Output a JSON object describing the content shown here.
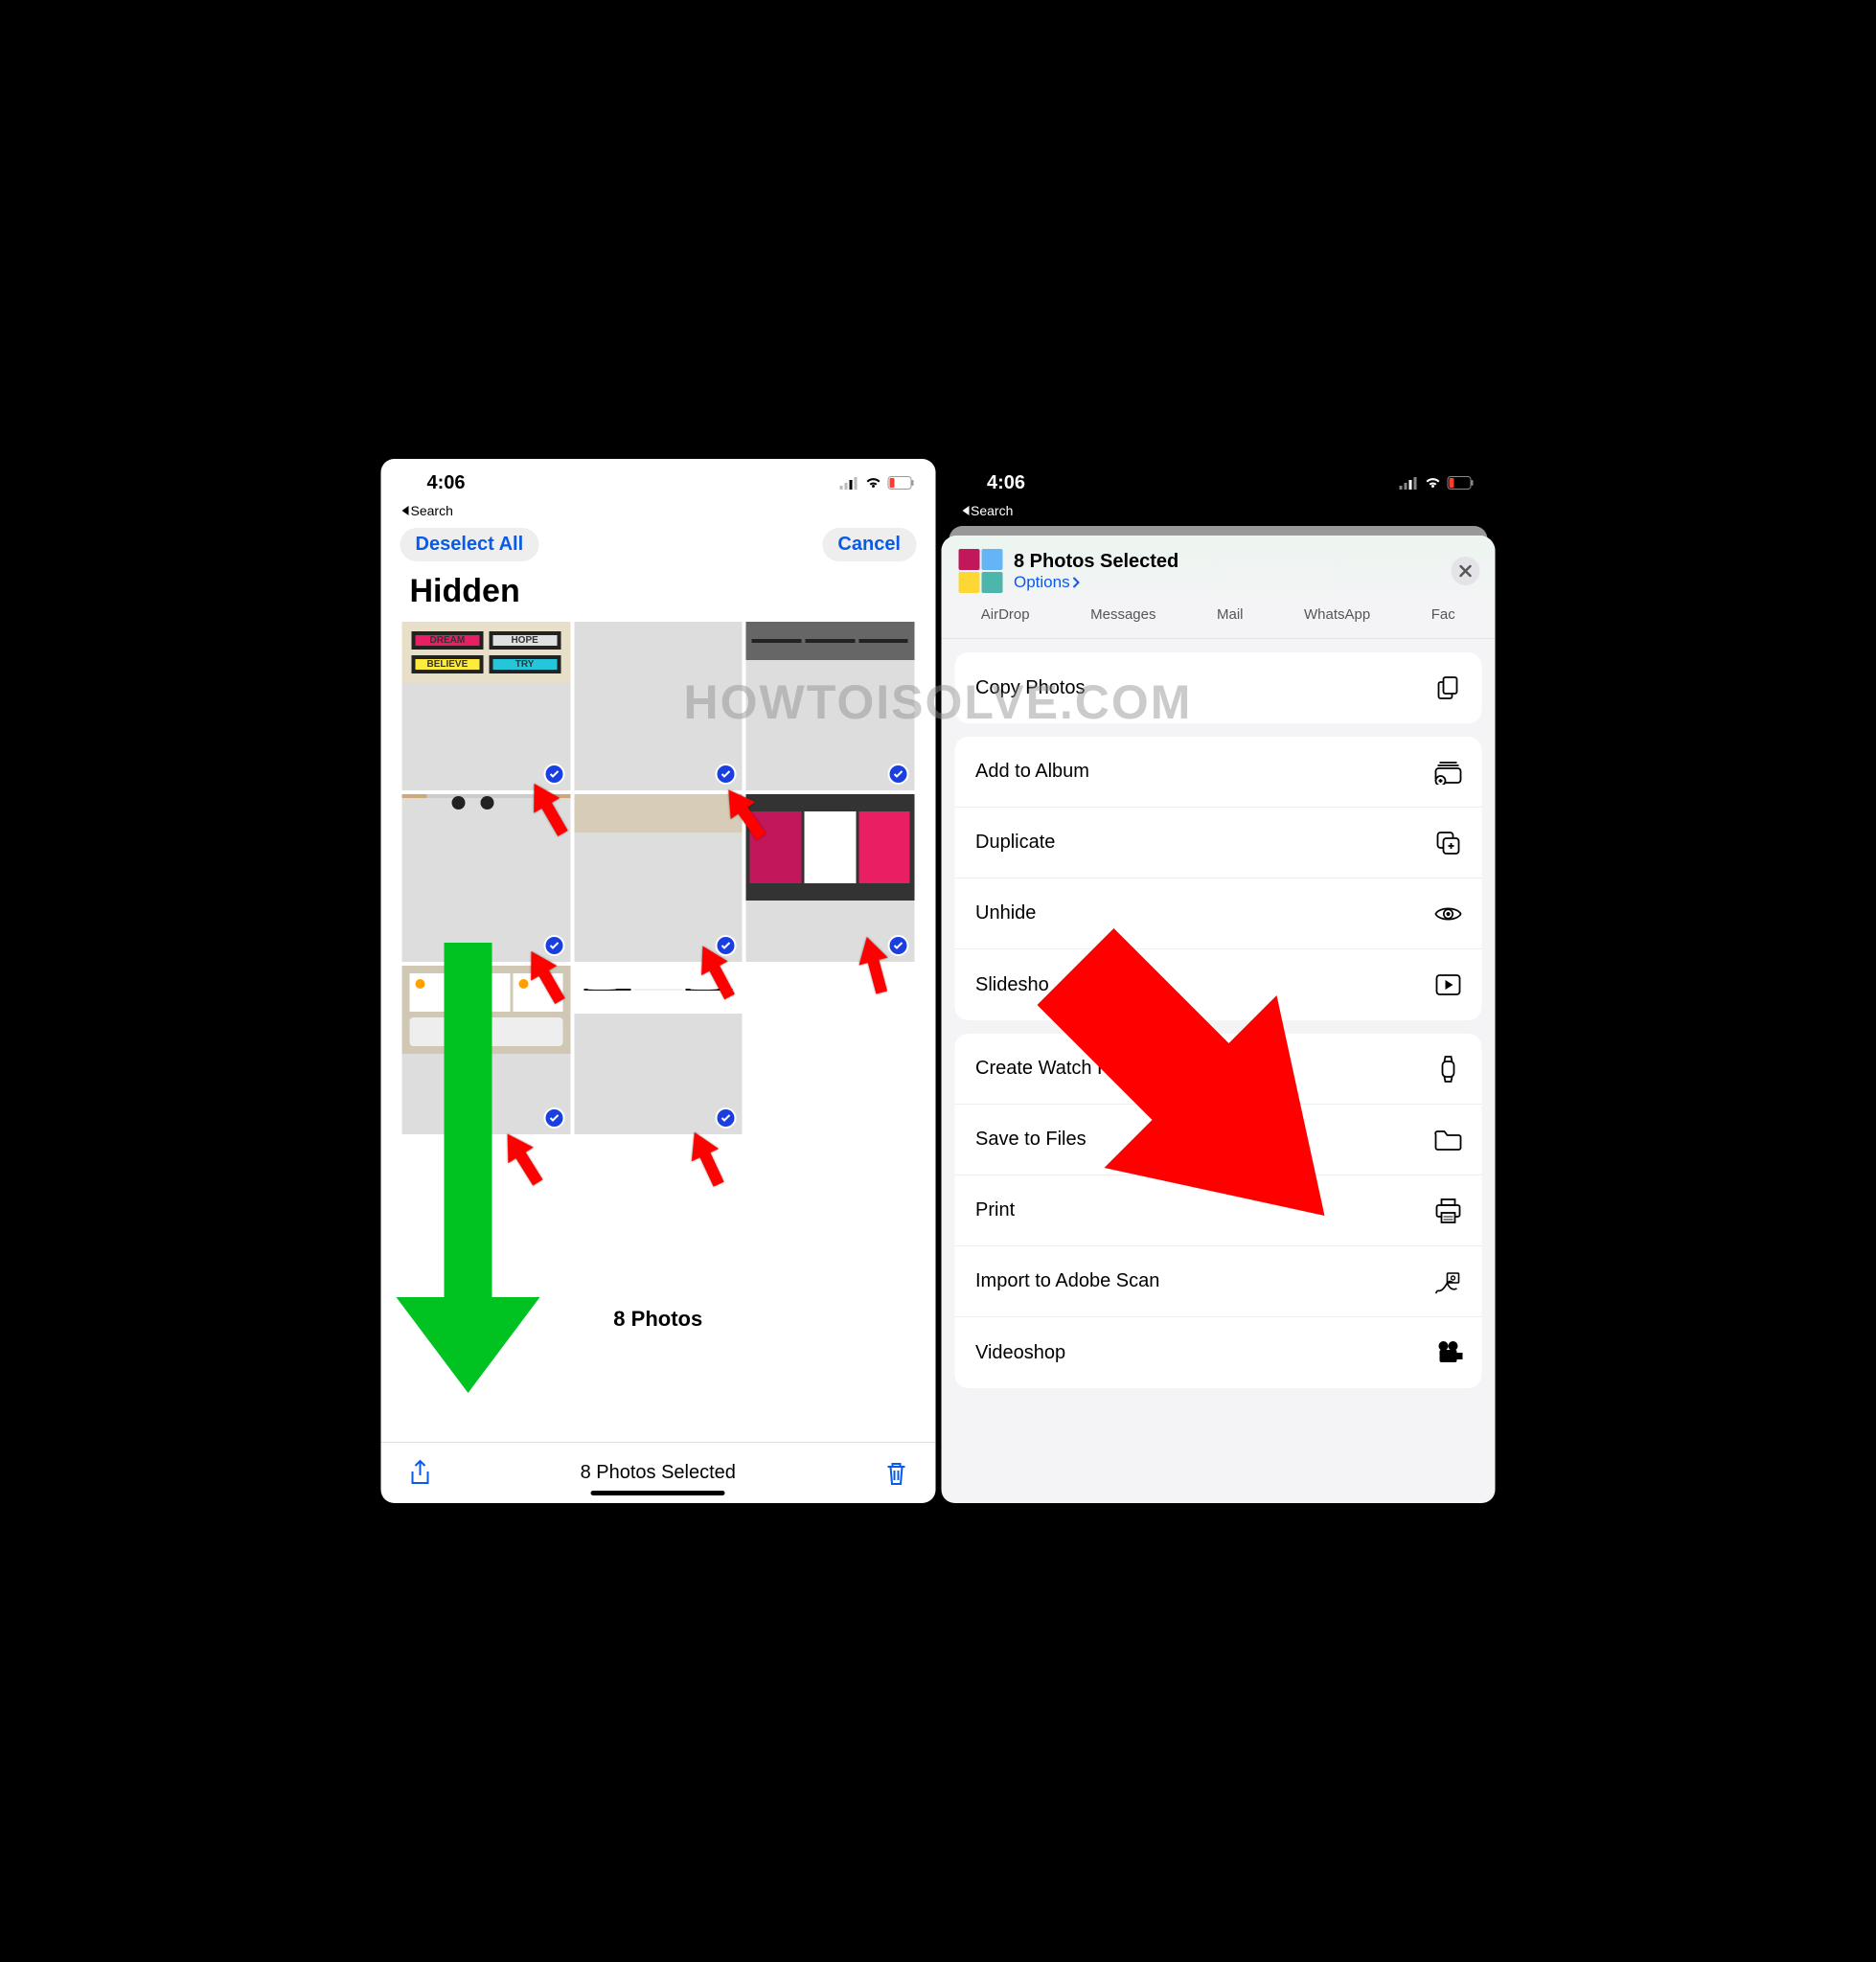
{
  "status": {
    "time": "4:06",
    "back_label": "Search"
  },
  "left": {
    "deselect": "Deselect All",
    "cancel": "Cancel",
    "title": "Hidden",
    "count": "8 Photos",
    "selected": "8 Photos Selected",
    "thumbs": [
      {
        "words": [
          "DREAM",
          "HOPE",
          "BELIEVE",
          "TRY"
        ]
      }
    ]
  },
  "right": {
    "sheet_title": "8 Photos Selected",
    "options": "Options",
    "apps": [
      "AirDrop",
      "Messages",
      "Mail",
      "WhatsApp",
      "Fac"
    ],
    "groups": [
      [
        {
          "label": "Copy Photos",
          "icon": "copy"
        }
      ],
      [
        {
          "label": "Add to Album",
          "icon": "album"
        },
        {
          "label": "Duplicate",
          "icon": "duplicate"
        },
        {
          "label": "Unhide",
          "icon": "eye"
        },
        {
          "label": "Slidesho",
          "icon": "play"
        }
      ],
      [
        {
          "label": "Create Watch Face",
          "icon": "watch"
        },
        {
          "label": "Save to Files",
          "icon": "folder"
        },
        {
          "label": "Print",
          "icon": "print"
        },
        {
          "label": "Import to Adobe Scan",
          "icon": "adobe"
        },
        {
          "label": "Videoshop",
          "icon": "video"
        }
      ]
    ]
  },
  "watermark": "HOWTOISOLVE.COM"
}
